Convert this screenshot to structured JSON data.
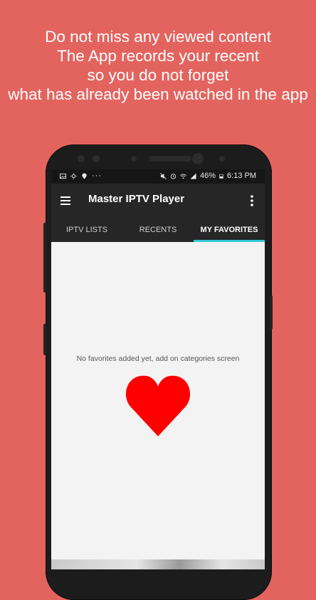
{
  "promo": {
    "lines": [
      "Do not miss any viewed content",
      "The App records your recent",
      "so you do not forget",
      "what has already been watched in the app"
    ]
  },
  "statusbar": {
    "battery": "46%",
    "time": "6:13 PM",
    "more": "···",
    "left_icons": [
      "photo-icon",
      "brightness-icon",
      "location-icon"
    ],
    "right_icons": [
      "mute-icon",
      "alarm-icon",
      "wifi-icon",
      "signal-icon",
      "battery-icon"
    ]
  },
  "appbar": {
    "title": "Master IPTV Player",
    "menu_icon": "hamburger-menu-icon",
    "more_icon": "more-vert-icon"
  },
  "tabs": [
    {
      "label": "IPTV LISTS",
      "active": false
    },
    {
      "label": "RECENTS",
      "active": false
    },
    {
      "label": "MY FAVORITES",
      "active": true
    }
  ],
  "content": {
    "empty_message": "No favorites added yet, add on categories screen",
    "heart_icon": "heart-icon",
    "heart_color": "#ff0000"
  },
  "colors": {
    "background": "#e3645f",
    "appbar": "#262626",
    "tab_indicator": "#35c8d6"
  }
}
